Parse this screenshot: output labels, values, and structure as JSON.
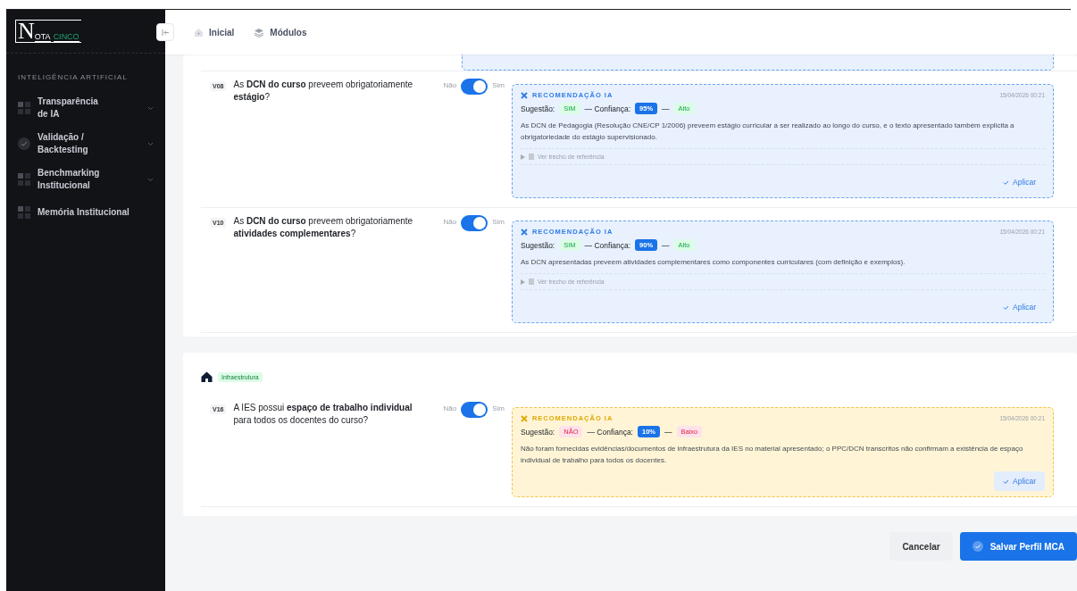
{
  "logo": {
    "initial": "N",
    "rest": "OTA",
    "accent": "CINCO"
  },
  "sidebar": {
    "section": "INTELIGÊNCIA ARTIFICIAL",
    "items": [
      {
        "label": "Transparência de IA",
        "kind": "grid",
        "expandable": true
      },
      {
        "label": "Validação / Backtesting",
        "kind": "check",
        "expandable": true
      },
      {
        "label": "Benchmarking Institucional",
        "kind": "grid",
        "expandable": true
      },
      {
        "label": "Memória Institucional",
        "kind": "grid",
        "expandable": false
      }
    ]
  },
  "header": {
    "breadcrumbs": [
      {
        "label": "Inicial",
        "kind": "home"
      },
      {
        "label": "Módulos",
        "kind": "layers"
      }
    ]
  },
  "sections": [
    {
      "partial_top": true,
      "questions": [
        {
          "code": "V08",
          "text": "As **DCN do curso** preveem obrigatoriamente **estágio**?",
          "no": "Não",
          "yes": "Sim",
          "on": true,
          "recommendation": {
            "kind": "positive",
            "title": "RECOMENDAÇÃO IA",
            "date": "15/04/2026 00:21",
            "suggestion_label": "Sugestão:",
            "suggestion": "SIM",
            "confidence_label": "— Confiança:",
            "confidence": "95%",
            "dash": "—",
            "level": "Alto",
            "body": "As DCN de Pedagogia (Resolução CNE/CP 1/2006) preveem estágio curricular a ser realizado ao longo do curso, e o texto apresentado também explicita a obrigatoriedade do estágio supervisionado.",
            "reference": "Ver trecho de referência",
            "apply": "Aplicar"
          }
        },
        {
          "code": "V10",
          "text": "As **DCN do curso** preveem obrigatoriamente **atividades complementares**?",
          "no": "Não",
          "yes": "Sim",
          "on": true,
          "recommendation": {
            "kind": "positive",
            "title": "RECOMENDAÇÃO IA",
            "date": "15/04/2026 00:21",
            "suggestion_label": "Sugestão:",
            "suggestion": "SIM",
            "confidence_label": "— Confiança:",
            "confidence": "90%",
            "dash": "—",
            "level": "Alto",
            "body": "As DCN apresentadas preveem atividades complementares como componentes curriculares (com definição e exemplos).",
            "reference": "Ver trecho de referência",
            "apply": "Aplicar"
          }
        }
      ]
    },
    {
      "tag": "Infraestrutura",
      "partial_top": false,
      "questions": [
        {
          "code": "V16",
          "text": "A IES possui **espaço de trabalho individual** para todos os docentes do curso?",
          "no": "Não",
          "yes": "Sim",
          "on": true,
          "recommendation": {
            "kind": "negative",
            "title": "RECOMENDAÇÃO IA",
            "date": "15/04/2026 00:21",
            "suggestion_label": "Sugestão:",
            "suggestion": "NÃO",
            "confidence_label": "— Confiança:",
            "confidence": "10%",
            "dash": "—",
            "level": "Baixo",
            "body": "Não foram fornecidas evidências/documentos de infraestrutura da IES no material apresentado; o PPC/DCN transcritos não confirmam a existência de espaço individual de trabalho para todos os docentes.",
            "apply": "Aplicar"
          }
        }
      ]
    }
  ],
  "footer": {
    "cancel": "Cancelar",
    "save": "Salvar Perfil MCA"
  }
}
